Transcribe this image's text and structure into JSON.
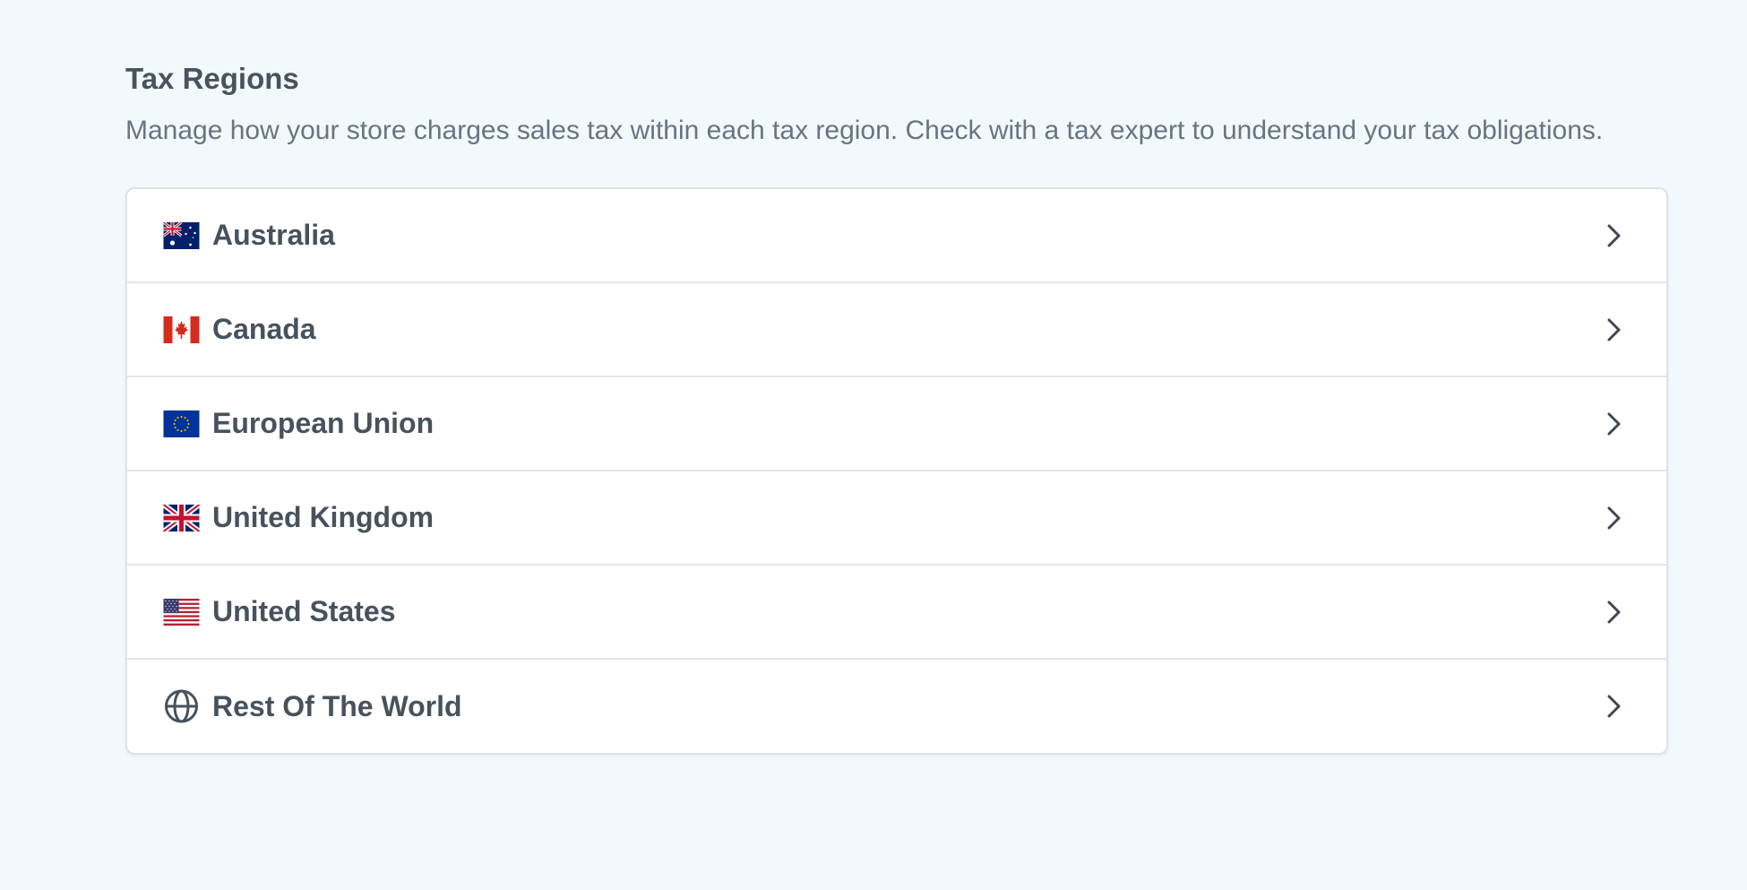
{
  "section": {
    "title": "Tax Regions",
    "description": "Manage how your store charges sales tax within each tax region. Check with a tax expert to understand your tax obligations."
  },
  "regions": [
    {
      "label": "Australia",
      "icon": "australia-flag-icon"
    },
    {
      "label": "Canada",
      "icon": "canada-flag-icon"
    },
    {
      "label": "European Union",
      "icon": "eu-flag-icon"
    },
    {
      "label": "United Kingdom",
      "icon": "uk-flag-icon"
    },
    {
      "label": "United States",
      "icon": "us-flag-icon"
    },
    {
      "label": "Rest Of The World",
      "icon": "globe-icon"
    }
  ],
  "colors": {
    "background": "#f1f9fc",
    "card": "#ffffff",
    "text": "#48525d",
    "muted": "#687482"
  }
}
